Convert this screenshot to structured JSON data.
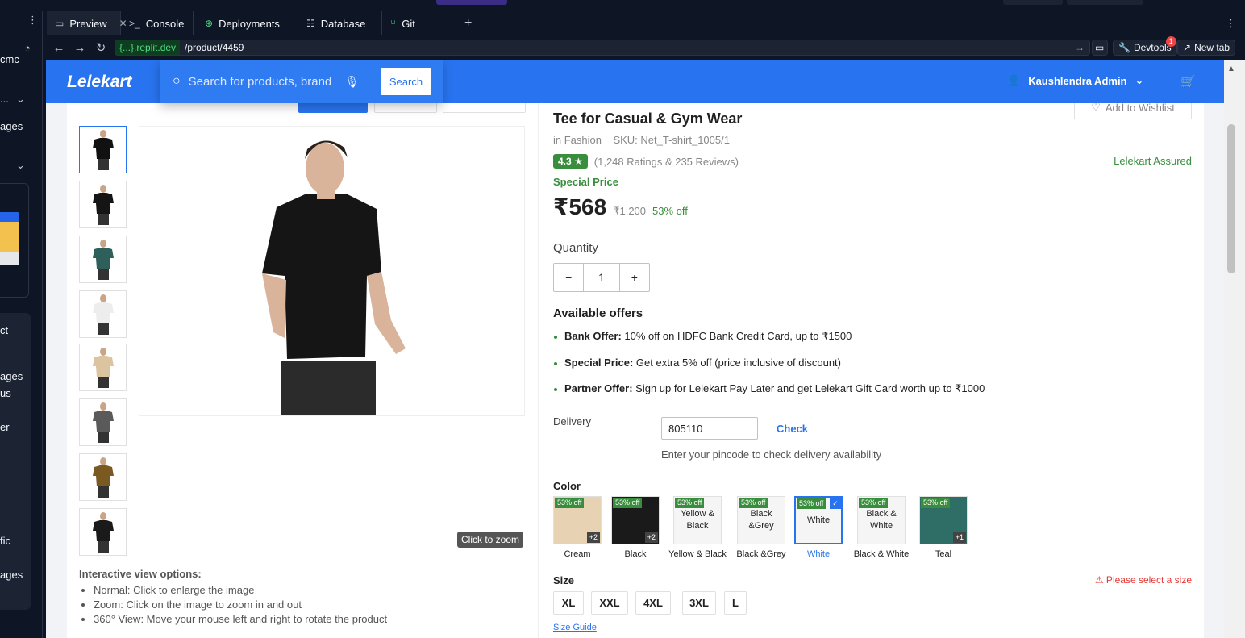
{
  "ide": {
    "left_labels": [
      "cmc",
      "...",
      "ages",
      "ct",
      "ages",
      "us",
      "er",
      "fic",
      "ages"
    ],
    "tabs": [
      {
        "label": "Preview",
        "icon": "monitor-icon"
      },
      {
        "label": "Console",
        "icon": "terminal-icon"
      },
      {
        "label": "Deployments",
        "icon": "globe-icon"
      },
      {
        "label": "Database",
        "icon": "database-icon"
      },
      {
        "label": "Git",
        "icon": "git-icon"
      }
    ],
    "url_domain": "{...}.replit.dev",
    "url_path": "/product/4459",
    "devtools_label": "Devtools",
    "devtools_badge": "1",
    "newtab_label": "New tab"
  },
  "header": {
    "logo": "Lelekart",
    "search_placeholder": "Search for products, brands and more",
    "search_button": "Search",
    "user_name": "Kaushlendra Admin"
  },
  "gallery": {
    "thumb_colors": [
      "#111111",
      "#151515",
      "#2f5f5b",
      "#ededed",
      "#dcc4a0",
      "#5a5a5a",
      "#7a5a20",
      "#1a1a1a"
    ],
    "zoom_tip": "Click to zoom",
    "view_title": "Interactive view options:",
    "view_options": [
      "Normal: Click to enlarge the image",
      "Zoom: Click on the image to zoom in and out",
      "360° View: Move your mouse left and right to rotate the product"
    ]
  },
  "product": {
    "title": "Tee for Casual & Gym Wear",
    "wishlist": "Add to Wishlist",
    "category": "in Fashion",
    "sku": "SKU: Net_T-shirt_1005/1",
    "rating": "4.3 ★",
    "ratings_text": "(1,248 Ratings & 235 Reviews)",
    "assured": "Lelekart Assured",
    "special_price": "Special Price",
    "price": "₹568",
    "mrp": "₹1,200",
    "discount": "53% off",
    "quantity_label": "Quantity",
    "quantity": "1",
    "offers_title": "Available offers",
    "offers": [
      {
        "label": "Bank Offer:",
        "text": "10% off on HDFC Bank Credit Card, up to ₹1500"
      },
      {
        "label": "Special Price:",
        "text": "Get extra 5% off (price inclusive of discount)"
      },
      {
        "label": "Partner Offer:",
        "text": "Sign up for Lelekart Pay Later and get Lelekart Gift Card worth up to ₹1000"
      }
    ],
    "delivery_label": "Delivery",
    "pincode": "805110",
    "check": "Check",
    "delivery_hint": "Enter your pincode to check delivery availability",
    "color_label": "Color",
    "colors": [
      {
        "name": "Cream",
        "inner": "",
        "more": "+2",
        "fill": "#e8d2b4"
      },
      {
        "name": "Black",
        "inner": "",
        "more": "+2",
        "fill": "#1a1a1a"
      },
      {
        "name": "Yellow & Black",
        "inner": "Yellow & Black",
        "more": "",
        "fill": ""
      },
      {
        "name": "Black &Grey",
        "inner": "Black &Grey",
        "more": "",
        "fill": ""
      },
      {
        "name": "White",
        "inner": "White",
        "more": "",
        "fill": ""
      },
      {
        "name": "Black & White",
        "inner": "Black & White",
        "more": "",
        "fill": ""
      },
      {
        "name": "Teal",
        "inner": "",
        "more": "+1",
        "fill": "#2f6e66"
      }
    ],
    "color_off": "53% off",
    "size_label": "Size",
    "size_warning": "⚠ Please select a size",
    "sizes": [
      "XL",
      "XXL",
      "4XL",
      "3XL",
      "L"
    ],
    "size_guide": "Size Guide"
  }
}
